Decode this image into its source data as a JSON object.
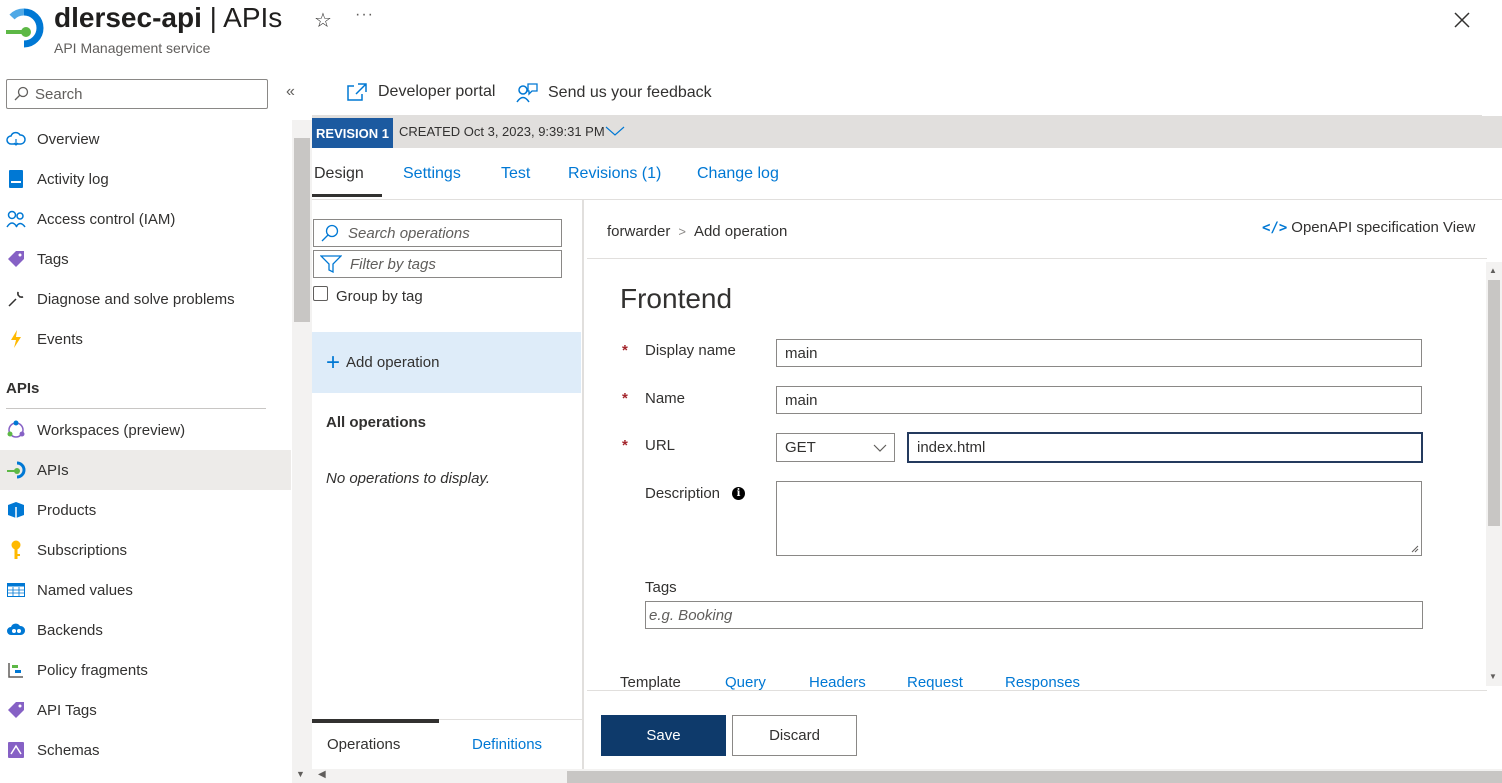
{
  "header": {
    "resource_name": "dlersec-api",
    "separator": " | ",
    "page_name": "APIs",
    "subtitle": "API Management service",
    "star_icon": "☆",
    "more_icon": "···"
  },
  "nav": {
    "search_placeholder": "Search",
    "collapse_icon": "«",
    "items": [
      {
        "label": "Overview",
        "icon": "cloud-icon"
      },
      {
        "label": "Activity log",
        "icon": "activity-log-icon"
      },
      {
        "label": "Access control (IAM)",
        "icon": "people-icon"
      },
      {
        "label": "Tags",
        "icon": "tag-icon"
      },
      {
        "label": "Diagnose and solve problems",
        "icon": "wrench-icon"
      },
      {
        "label": "Events",
        "icon": "lightning-icon"
      }
    ],
    "section_label": "APIs",
    "section_items": [
      {
        "label": "Workspaces (preview)",
        "icon": "workspaces-icon"
      },
      {
        "label": "APIs",
        "icon": "api-icon",
        "selected": true
      },
      {
        "label": "Products",
        "icon": "products-icon"
      },
      {
        "label": "Subscriptions",
        "icon": "key-icon"
      },
      {
        "label": "Named values",
        "icon": "table-icon"
      },
      {
        "label": "Backends",
        "icon": "backends-icon"
      },
      {
        "label": "Policy fragments",
        "icon": "policy-icon"
      },
      {
        "label": "API Tags",
        "icon": "tag-icon"
      },
      {
        "label": "Schemas",
        "icon": "schemas-icon"
      }
    ]
  },
  "commands": {
    "developer_portal": "Developer portal",
    "feedback": "Send us your feedback"
  },
  "revision": {
    "badge": "REVISION 1",
    "created": "CREATED Oct 3, 2023, 9:39:31 PM"
  },
  "tabs": [
    {
      "label": "Design",
      "active": true
    },
    {
      "label": "Settings"
    },
    {
      "label": "Test"
    },
    {
      "label": "Revisions (1)"
    },
    {
      "label": "Change log"
    }
  ],
  "operations": {
    "search_placeholder": "Search operations",
    "filter_placeholder": "Filter by tags",
    "group_by_tag": "Group by tag",
    "add_operation": "Add operation",
    "all_operations": "All operations",
    "empty_message": "No operations to display.",
    "bottom_tabs": {
      "operations": "Operations",
      "definitions": "Definitions"
    }
  },
  "editor": {
    "breadcrumb": {
      "parent": "forwarder",
      "separator": ">",
      "current": "Add operation"
    },
    "openapi_view": "OpenAPI specification View",
    "section_title": "Frontend",
    "required_mark": "*",
    "display_name": {
      "label": "Display name",
      "value": "main"
    },
    "name": {
      "label": "Name",
      "value": "main"
    },
    "url": {
      "label": "URL",
      "method": "GET",
      "path": "index.html"
    },
    "description": {
      "label": "Description",
      "value": ""
    },
    "tags": {
      "label": "Tags",
      "placeholder": "e.g. Booking"
    },
    "sub_tabs": [
      {
        "label": "Template",
        "active": true
      },
      {
        "label": "Query"
      },
      {
        "label": "Headers"
      },
      {
        "label": "Request"
      },
      {
        "label": "Responses"
      }
    ]
  },
  "buttons": {
    "save": "Save",
    "discard": "Discard"
  },
  "colors": {
    "accent": "#0078d4",
    "primary_button": "#0e3a6b",
    "revision_badge": "#1c5aa0",
    "selection": "#deecf9"
  }
}
